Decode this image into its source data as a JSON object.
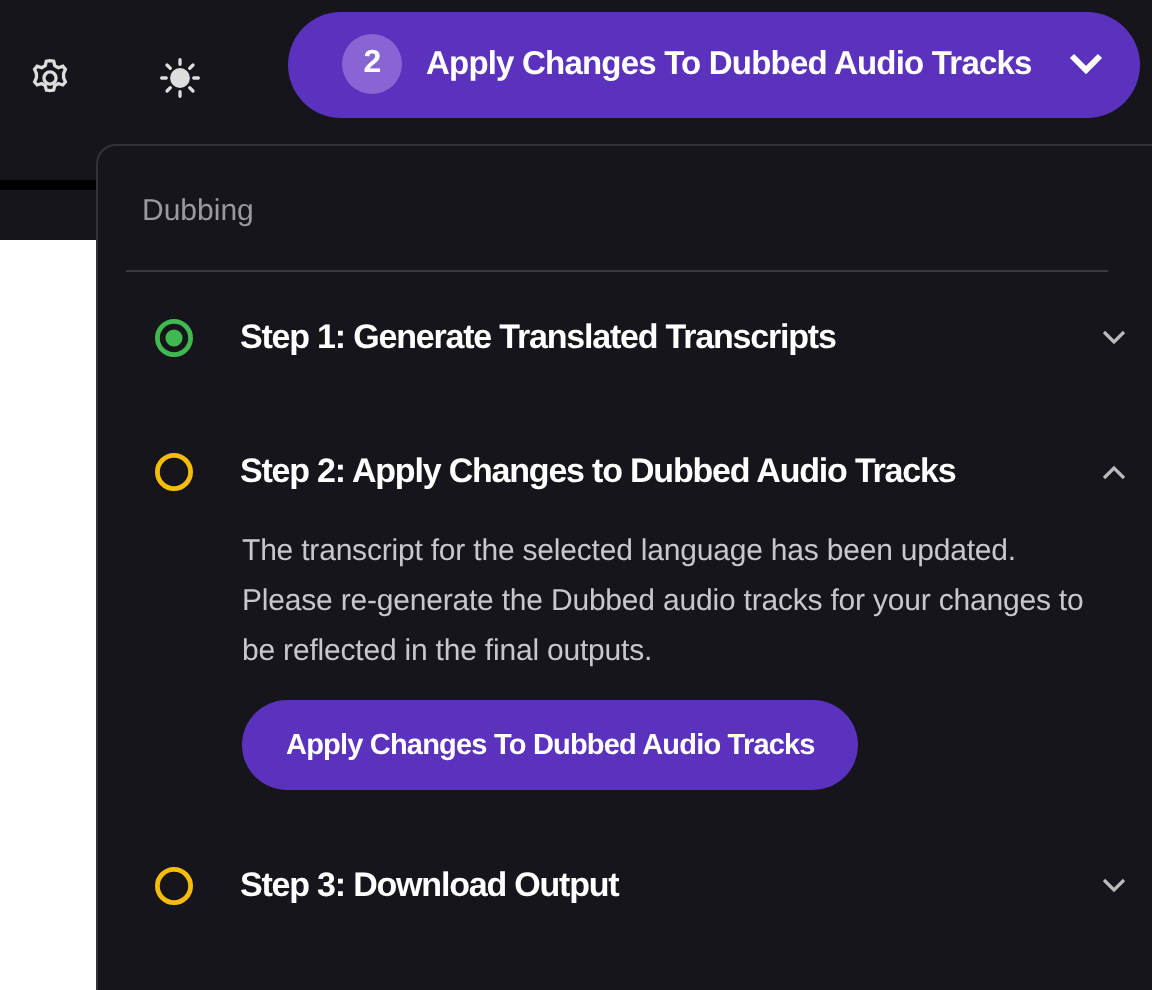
{
  "toolbar": {
    "pending_count": "2",
    "action": "Apply Changes To Dubbed Audio Tracks"
  },
  "menu": {
    "title": "Dubbing",
    "steps": [
      {
        "title": "Step 1: Generate Translated Transcripts",
        "completed": true,
        "expanded": false
      },
      {
        "title": "Step 2: Apply Changes to Dubbed Audio Tracks",
        "completed": false,
        "expanded": true,
        "description": "The transcript for the selected language has been updated. Please re-generate the Dubbed audio tracks for your changes to be reflected in the final outputs.",
        "button": "Apply Changes To Dubbed Audio Tracks"
      },
      {
        "title": "Step 3: Download Output",
        "completed": false,
        "expanded": false
      }
    ]
  }
}
